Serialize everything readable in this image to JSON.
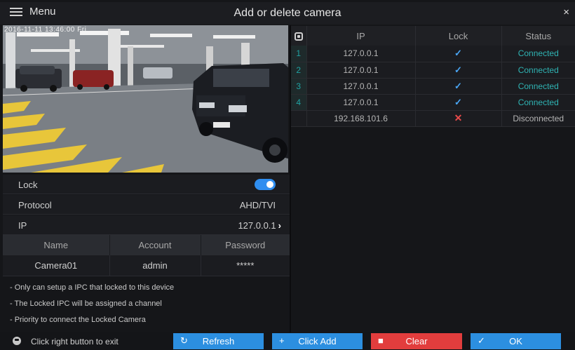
{
  "header": {
    "menu_label": "Menu",
    "title": "Add or delete camera",
    "close_glyph": "×"
  },
  "preview": {
    "osd_timestamp": "2016-11-11  13:46:00 Fri"
  },
  "properties": {
    "lock_label": "Lock",
    "lock_enabled": true,
    "protocol_label": "Protocol",
    "protocol_value": "AHD/TVI",
    "ip_label": "IP",
    "ip_value": "127.0.0.1"
  },
  "credentials": {
    "headers": [
      "Name",
      "Account",
      "Password"
    ],
    "row": [
      "Camera01",
      "admin",
      "*****"
    ]
  },
  "notes": [
    "- Only can setup a IPC that locked to this device",
    "- The Locked IPC will be assigned a channel",
    "- Priority to connect the Locked Camera"
  ],
  "camera_table": {
    "headers": {
      "ip": "IP",
      "lock": "Lock",
      "status": "Status"
    },
    "rows": [
      {
        "index": "1",
        "ip": "127.0.0.1",
        "lock": "✓",
        "status": "Connected"
      },
      {
        "index": "2",
        "ip": "127.0.0.1",
        "lock": "✓",
        "status": "Connected"
      },
      {
        "index": "3",
        "ip": "127.0.0.1",
        "lock": "✓",
        "status": "Connected"
      },
      {
        "index": "4",
        "ip": "127.0.0.1",
        "lock": "✓",
        "status": "Connected"
      },
      {
        "index": "",
        "ip": "192.168.101.6",
        "lock": "✕",
        "status": "Disconnected"
      }
    ]
  },
  "footer": {
    "hint": "Click right button to exit",
    "buttons": {
      "refresh": "Refresh",
      "add": "Click Add",
      "clear": "Clear",
      "ok": "OK"
    }
  },
  "colors": {
    "accent_blue": "#2c8fe0",
    "danger_red": "#e23d3d",
    "connected_teal": "#2fb3b3"
  },
  "icons": {
    "menu": "hamburger-icon",
    "close": "close-icon",
    "toggle": "toggle-switch",
    "refresh": "refresh-icon",
    "add": "plus-icon",
    "clear": "trash-icon",
    "ok": "check-icon",
    "hint": "mouse-icon"
  }
}
